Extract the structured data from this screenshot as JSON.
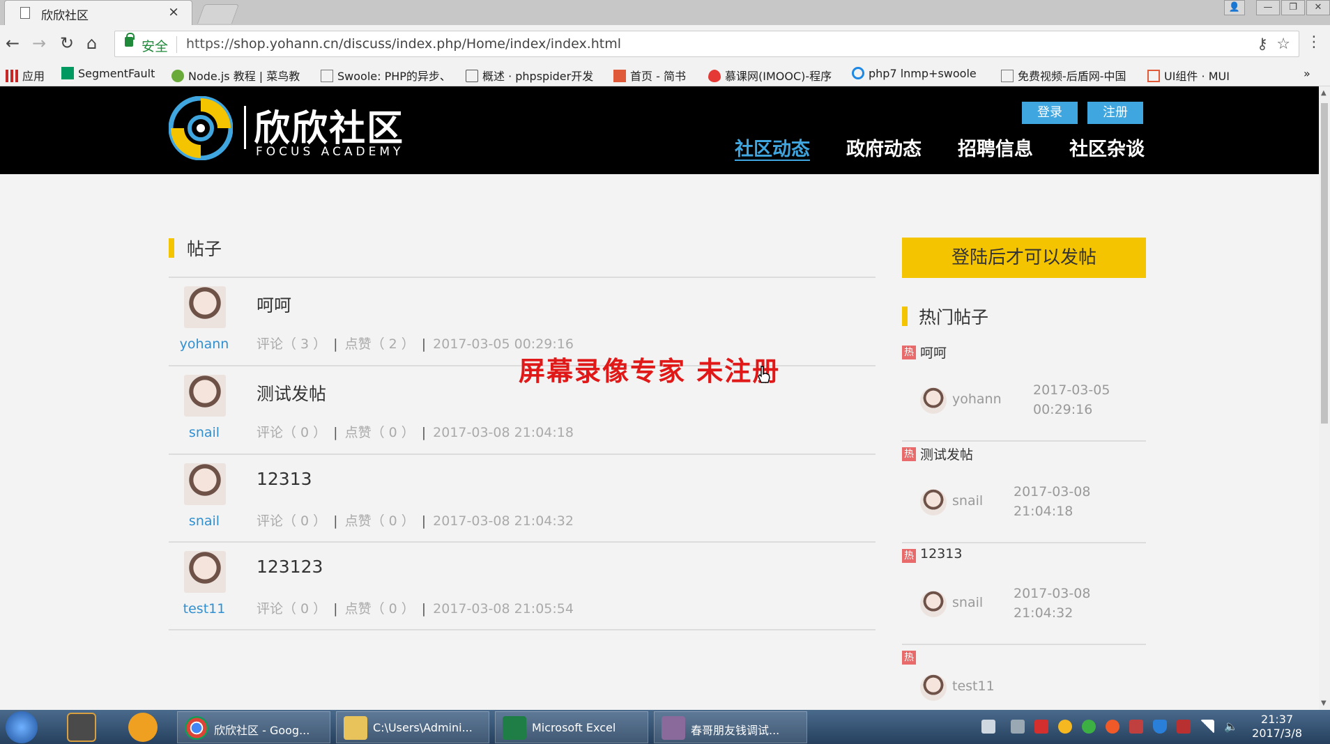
{
  "browser": {
    "tab_title": "欣欣社区",
    "tab_close": "×",
    "secure_label": "安全",
    "url_prefix": "https://",
    "url_rest": "shop.yohann.cn/discuss/index.php/Home/index/index.html",
    "bookmarks": [
      {
        "label": "应用",
        "icon": "apps-grid-icon",
        "color": "#c62828"
      },
      {
        "label": "SegmentFault",
        "icon": "segmentfault-icon",
        "color": "#009a61"
      },
      {
        "label": "Node.js 教程 | 菜鸟教",
        "icon": "runoob-icon",
        "color": "#6aaa3a"
      },
      {
        "label": "Swoole: PHP的异步、",
        "icon": "page-icon",
        "color": "#777777"
      },
      {
        "label": "概述 · phpspider开发",
        "icon": "book-icon",
        "color": "#555555"
      },
      {
        "label": "首页 - 简书",
        "icon": "jianshu-icon",
        "color": "#e05a3a"
      },
      {
        "label": "慕课网(IMOOC)-程序",
        "icon": "imooc-flame-icon",
        "color": "#e53935"
      },
      {
        "label": "php7 lnmp+swoole",
        "icon": "circle-icon",
        "color": "#1e88e5"
      },
      {
        "label": "免费视频-后盾网-中国",
        "icon": "page-icon",
        "color": "#777777"
      },
      {
        "label": "UI组件 · MUI",
        "icon": "mui-tag-icon",
        "color": "#e05a3a"
      }
    ],
    "bookmarks_more": "»"
  },
  "site": {
    "logo_cn": "欣欣社区",
    "logo_en": "FOCUS ACADEMY",
    "login_label": "登录",
    "register_label": "注册",
    "nav": [
      "社区动态",
      "政府动态",
      "招聘信息",
      "社区杂谈"
    ],
    "active_nav": "社区动态",
    "accent_color": "#3fa6e0",
    "highlight_color": "#f5c400"
  },
  "posts": {
    "section_title": "帖子",
    "items": [
      {
        "title": "呵呵",
        "author": "yohann",
        "comments": "评论（ 3 ）",
        "likes": "点赞（ 2 ）",
        "time": "2017-03-05 00:29:16"
      },
      {
        "title": "测试发帖",
        "author": "snail",
        "comments": "评论（ 0 ）",
        "likes": "点赞（ 0 ）",
        "time": "2017-03-08 21:04:18"
      },
      {
        "title": "12313",
        "author": "snail",
        "comments": "评论（ 0 ）",
        "likes": "点赞（ 0 ）",
        "time": "2017-03-08 21:04:32"
      },
      {
        "title": "123123",
        "author": "test11",
        "comments": "评论（ 0 ）",
        "likes": "点赞（ 0 ）",
        "time": "2017-03-08 21:05:54"
      }
    ]
  },
  "sidebar": {
    "post_button": "登陆后才可以发帖",
    "hot_title": "热门帖子",
    "hot_tag": "热",
    "hot": [
      {
        "title": "呵呵",
        "author": "yohann",
        "time": "2017-03-05\n00:29:16"
      },
      {
        "title": "测试发帖",
        "author": "snail",
        "time": "2017-03-08\n21:04:18"
      },
      {
        "title": "12313",
        "author": "snail",
        "time": "2017-03-08\n21:04:32"
      },
      {
        "title": "",
        "author": "test11",
        "time": ""
      }
    ]
  },
  "watermark": "屏幕录像专家  未注册",
  "taskbar": {
    "apps": [
      {
        "label": "欣欣社区 - Goog...",
        "icon": "chrome-icon",
        "color": "#db4437"
      },
      {
        "label": "C:\\Users\\Admini...",
        "icon": "folder-icon",
        "color": "#e8c25a"
      },
      {
        "label": "Microsoft Excel",
        "icon": "excel-icon",
        "color": "#1e7e45"
      },
      {
        "label": "春哥朋友钱调试...",
        "icon": "avatar-app-icon",
        "color": "#8a6a9a"
      }
    ],
    "time": "21:37",
    "date": "2017/3/8"
  }
}
